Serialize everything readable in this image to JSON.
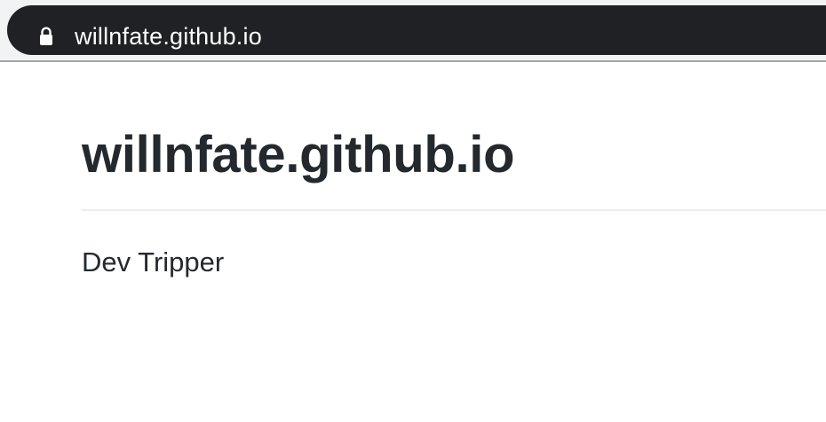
{
  "browser": {
    "url": "willnfate.github.io",
    "security_icon": "lock-icon",
    "colors": {
      "toolbar_background": "#f1f3f4",
      "address_bar_background": "#202124",
      "url_text": "#ffffff"
    }
  },
  "page": {
    "title": "willnfate.github.io",
    "description": "Dev Tripper",
    "colors": {
      "text": "#24292e",
      "divider": "#eaecef",
      "background": "#ffffff"
    }
  }
}
